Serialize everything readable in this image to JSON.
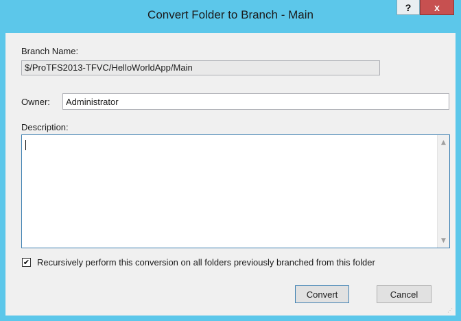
{
  "window": {
    "title": "Convert Folder to Branch - Main",
    "help_label": "?",
    "close_label": "x"
  },
  "form": {
    "branch_name_label": "Branch Name:",
    "branch_name_value": "$/ProTFS2013-TFVC/HelloWorldApp/Main",
    "owner_label": "Owner:",
    "owner_value": "Administrator",
    "description_label": "Description:",
    "description_value": "",
    "recursive_checked": true,
    "recursive_check_glyph": "✔",
    "recursive_label": "Recursively perform this conversion on all folders previously branched from this folder"
  },
  "buttons": {
    "convert_label": "Convert",
    "cancel_label": "Cancel"
  },
  "scroll": {
    "up_glyph": "▲",
    "down_glyph": "▼"
  },
  "colors": {
    "titlebar": "#5cc7ea",
    "close_button": "#c75050",
    "focus_border": "#3c7fb1"
  }
}
